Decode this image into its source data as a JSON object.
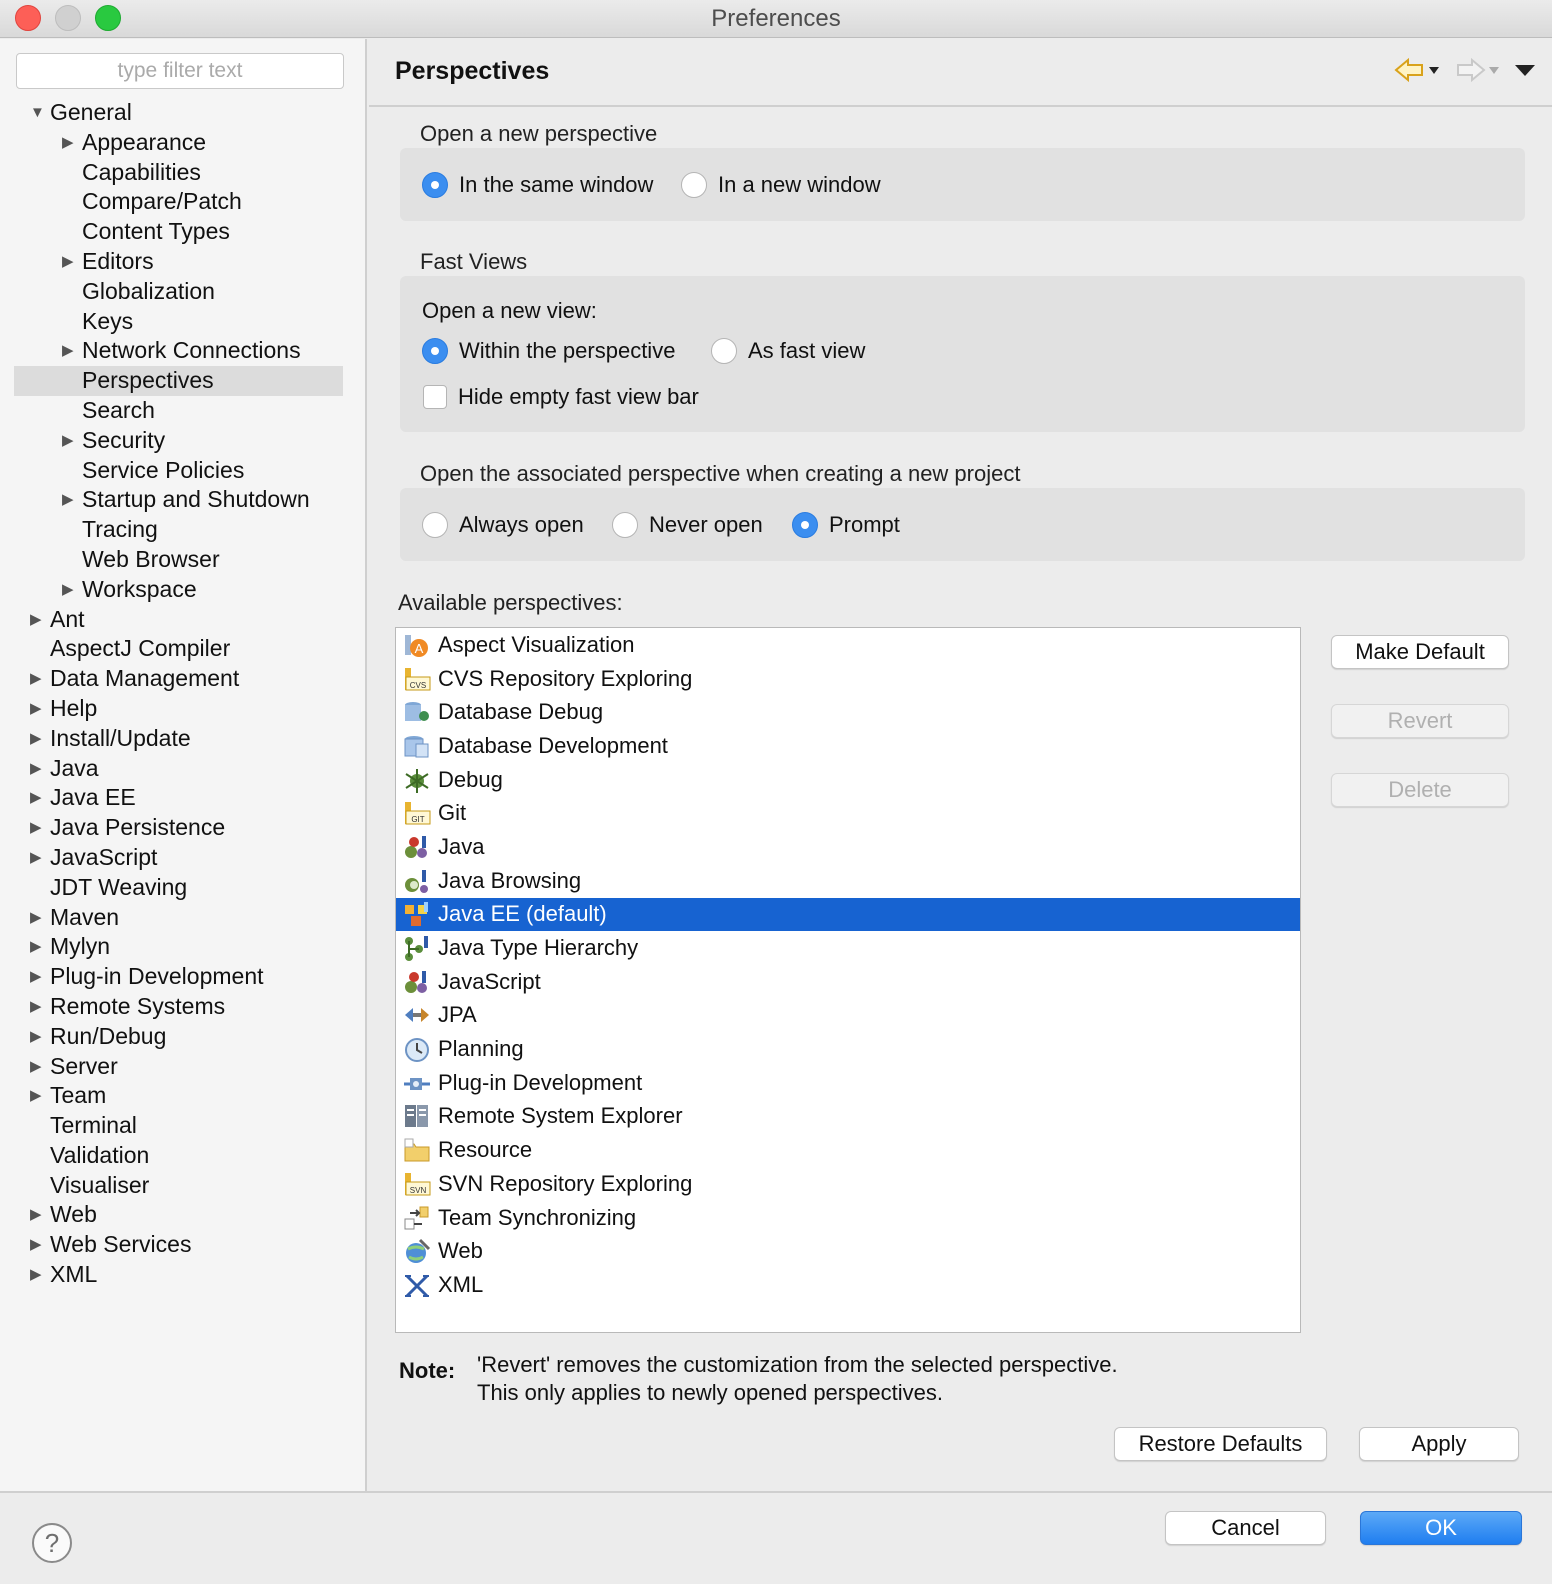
{
  "window": {
    "title": "Preferences"
  },
  "sidebar": {
    "filter_placeholder": "type filter text",
    "tree": [
      {
        "label": "General",
        "level": 0,
        "expander": "expanded"
      },
      {
        "label": "Appearance",
        "level": 1,
        "expander": "collapsed"
      },
      {
        "label": "Capabilities",
        "level": 1,
        "expander": "none"
      },
      {
        "label": "Compare/Patch",
        "level": 1,
        "expander": "none"
      },
      {
        "label": "Content Types",
        "level": 1,
        "expander": "none"
      },
      {
        "label": "Editors",
        "level": 1,
        "expander": "collapsed"
      },
      {
        "label": "Globalization",
        "level": 1,
        "expander": "none"
      },
      {
        "label": "Keys",
        "level": 1,
        "expander": "none"
      },
      {
        "label": "Network Connections",
        "level": 1,
        "expander": "collapsed"
      },
      {
        "label": "Perspectives",
        "level": 1,
        "expander": "none",
        "selected": true
      },
      {
        "label": "Search",
        "level": 1,
        "expander": "none"
      },
      {
        "label": "Security",
        "level": 1,
        "expander": "collapsed"
      },
      {
        "label": "Service Policies",
        "level": 1,
        "expander": "none"
      },
      {
        "label": "Startup and Shutdown",
        "level": 1,
        "expander": "collapsed"
      },
      {
        "label": "Tracing",
        "level": 1,
        "expander": "none"
      },
      {
        "label": "Web Browser",
        "level": 1,
        "expander": "none"
      },
      {
        "label": "Workspace",
        "level": 1,
        "expander": "collapsed"
      },
      {
        "label": "Ant",
        "level": 0,
        "expander": "collapsed"
      },
      {
        "label": "AspectJ Compiler",
        "level": 0,
        "expander": "none"
      },
      {
        "label": "Data Management",
        "level": 0,
        "expander": "collapsed"
      },
      {
        "label": "Help",
        "level": 0,
        "expander": "collapsed"
      },
      {
        "label": "Install/Update",
        "level": 0,
        "expander": "collapsed"
      },
      {
        "label": "Java",
        "level": 0,
        "expander": "collapsed"
      },
      {
        "label": "Java EE",
        "level": 0,
        "expander": "collapsed"
      },
      {
        "label": "Java Persistence",
        "level": 0,
        "expander": "collapsed"
      },
      {
        "label": "JavaScript",
        "level": 0,
        "expander": "collapsed"
      },
      {
        "label": "JDT Weaving",
        "level": 0,
        "expander": "none"
      },
      {
        "label": "Maven",
        "level": 0,
        "expander": "collapsed"
      },
      {
        "label": "Mylyn",
        "level": 0,
        "expander": "collapsed"
      },
      {
        "label": "Plug-in Development",
        "level": 0,
        "expander": "collapsed"
      },
      {
        "label": "Remote Systems",
        "level": 0,
        "expander": "collapsed"
      },
      {
        "label": "Run/Debug",
        "level": 0,
        "expander": "collapsed"
      },
      {
        "label": "Server",
        "level": 0,
        "expander": "collapsed"
      },
      {
        "label": "Team",
        "level": 0,
        "expander": "collapsed"
      },
      {
        "label": "Terminal",
        "level": 0,
        "expander": "none"
      },
      {
        "label": "Validation",
        "level": 0,
        "expander": "none"
      },
      {
        "label": "Visualiser",
        "level": 0,
        "expander": "none"
      },
      {
        "label": "Web",
        "level": 0,
        "expander": "collapsed"
      },
      {
        "label": "Web Services",
        "level": 0,
        "expander": "collapsed"
      },
      {
        "label": "XML",
        "level": 0,
        "expander": "collapsed"
      }
    ]
  },
  "page": {
    "title": "Perspectives",
    "nav_icons": [
      "back-arrow-icon",
      "forward-arrow-icon",
      "view-menu-icon"
    ],
    "open_perspective": {
      "label": "Open a new perspective",
      "options": [
        {
          "label": "In the same window",
          "checked": true
        },
        {
          "label": "In a new window",
          "checked": false
        }
      ]
    },
    "fast_views": {
      "label": "Fast Views",
      "open_view_label": "Open a new view:",
      "options": [
        {
          "label": "Within the perspective",
          "checked": true
        },
        {
          "label": "As fast view",
          "checked": false
        }
      ],
      "hide_bar": {
        "label": "Hide empty fast view bar",
        "checked": false
      }
    },
    "associated": {
      "label": "Open the associated perspective when creating a new project",
      "options": [
        {
          "label": "Always open",
          "checked": false
        },
        {
          "label": "Never open",
          "checked": false
        },
        {
          "label": "Prompt",
          "checked": true
        }
      ]
    },
    "available": {
      "label": "Available perspectives:",
      "items": [
        {
          "label": "Aspect Visualization",
          "icon": "aspect-visualization-icon"
        },
        {
          "label": "CVS Repository Exploring",
          "icon": "cvs-icon"
        },
        {
          "label": "Database Debug",
          "icon": "database-debug-icon"
        },
        {
          "label": "Database Development",
          "icon": "database-icon"
        },
        {
          "label": "Debug",
          "icon": "bug-icon"
        },
        {
          "label": "Git",
          "icon": "git-icon"
        },
        {
          "label": "Java",
          "icon": "java-icon"
        },
        {
          "label": "Java Browsing",
          "icon": "java-browsing-icon"
        },
        {
          "label": "Java EE (default)",
          "icon": "java-ee-icon",
          "selected": true
        },
        {
          "label": "Java Type Hierarchy",
          "icon": "hierarchy-icon"
        },
        {
          "label": "JavaScript",
          "icon": "javascript-icon"
        },
        {
          "label": "JPA",
          "icon": "jpa-icon"
        },
        {
          "label": "Planning",
          "icon": "clock-icon"
        },
        {
          "label": "Plug-in Development",
          "icon": "plugin-icon"
        },
        {
          "label": "Remote System Explorer",
          "icon": "remote-system-icon"
        },
        {
          "label": "Resource",
          "icon": "folder-icon"
        },
        {
          "label": "SVN Repository Exploring",
          "icon": "svn-icon"
        },
        {
          "label": "Team Synchronizing",
          "icon": "sync-icon"
        },
        {
          "label": "Web",
          "icon": "globe-icon"
        },
        {
          "label": "XML",
          "icon": "xml-icon"
        }
      ]
    },
    "buttons": {
      "make_default": "Make Default",
      "revert": "Revert",
      "delete": "Delete",
      "restore_defaults": "Restore Defaults",
      "apply": "Apply"
    },
    "note": {
      "label": "Note:",
      "line1": "'Revert' removes the customization from the selected perspective.",
      "line2": "This only applies to newly opened perspectives."
    }
  },
  "footer": {
    "help": "?",
    "cancel": "Cancel",
    "ok": "OK"
  },
  "colors": {
    "selection": "#1763d1",
    "radio_on": "#3b8ef0",
    "ok_button": "#1f7ef0"
  }
}
